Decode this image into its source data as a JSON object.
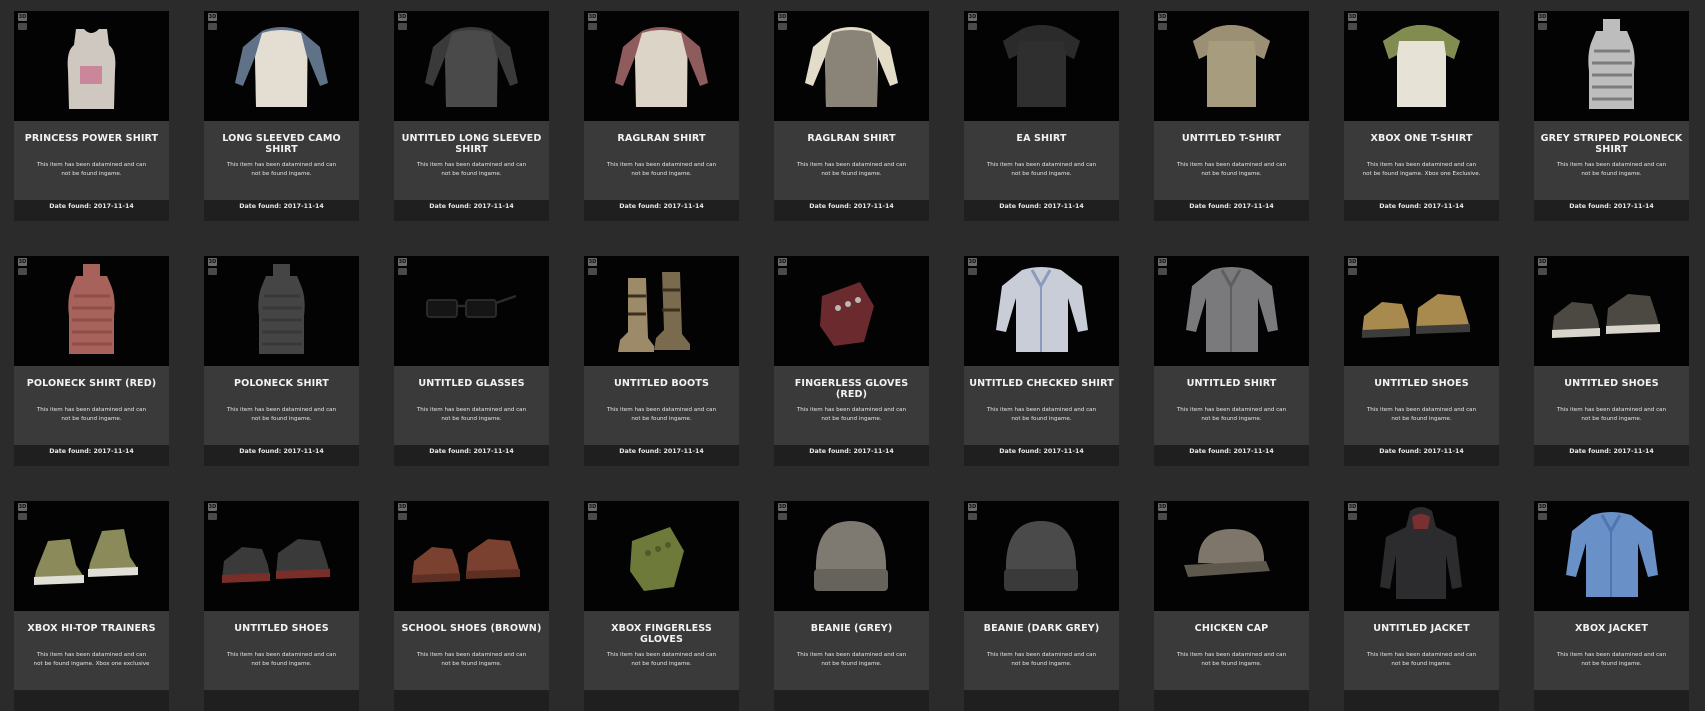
{
  "items": [
    {
      "title": "PRINCESS POWER SHIRT",
      "description": "This item has been datamined and can not be found ingame.",
      "date_found": "Date found: 2017-11-14",
      "icon": "tank-top-shirt-icon",
      "colors": [
        "#cfc8c0",
        "#c86a8a"
      ],
      "badges": [
        "3D",
        "XB"
      ]
    },
    {
      "title": "LONG SLEEVED CAMO SHIRT",
      "description": "This item has been datamined and can not be found ingame.",
      "date_found": "Date found: 2017-11-14",
      "icon": "long-sleeve-shirt-icon",
      "colors": [
        "#e3ddd2",
        "#5f7288"
      ],
      "badges": [
        "3D",
        "XB"
      ]
    },
    {
      "title": "UNTITLED LONG SLEEVED SHIRT",
      "description": "This item has been datamined and can not be found ingame.",
      "date_found": "Date found: 2017-11-14",
      "icon": "long-sleeve-shirt-icon",
      "colors": [
        "#4a4a4a",
        "#3a3a3a"
      ],
      "badges": [
        "3D",
        "XB"
      ]
    },
    {
      "title": "RAGLRAN SHIRT",
      "description": "This item has been datamined and can not be found ingame.",
      "date_found": "Date found: 2017-11-14",
      "icon": "long-sleeve-shirt-icon",
      "colors": [
        "#ddd4c8",
        "#8f5c5e"
      ],
      "badges": [
        "3D",
        "XB"
      ]
    },
    {
      "title": "RAGLRAN SHIRT",
      "description": "This item has been datamined and can not be found ingame.",
      "date_found": "Date found: 2017-11-14",
      "icon": "long-sleeve-shirt-icon",
      "colors": [
        "#8a8478",
        "#e2dcc8"
      ],
      "badges": [
        "3D",
        "XB"
      ]
    },
    {
      "title": "EA SHIRT",
      "description": "This item has been datamined and can not be found ingame.",
      "date_found": "Date found: 2017-11-14",
      "icon": "t-shirt-icon",
      "colors": [
        "#2f2f2f",
        "#2a2a2a"
      ],
      "badges": [
        "3D",
        "XB"
      ]
    },
    {
      "title": "UNTITLED T-SHIRT",
      "description": "This item has been datamined and can not be found ingame.",
      "date_found": "Date found: 2017-11-14",
      "icon": "t-shirt-icon",
      "colors": [
        "#a89c7e",
        "#9a8e72"
      ],
      "badges": [
        "3D",
        "XB"
      ]
    },
    {
      "title": "XBOX ONE T-SHIRT",
      "description": "This item has been datamined and can not be found ingame. Xbox one Exclusive.",
      "date_found": "Date found: 2017-11-14",
      "icon": "t-shirt-icon",
      "colors": [
        "#e6e2d6",
        "#6f7d3a"
      ],
      "badges": [
        "3D",
        "XB"
      ]
    },
    {
      "title": "GREY STRIPED POLONECK SHIRT",
      "description": "This item has been datamined and can not be found ingame.",
      "date_found": "Date found: 2017-11-14",
      "icon": "poloneck-shirt-icon",
      "colors": [
        "#bdbdbd",
        "#7c7c7c"
      ],
      "badges": [
        "3D",
        "XB"
      ]
    },
    {
      "title": "POLONECK SHIRT (RED)",
      "description": "This item has been datamined and can not be found ingame.",
      "date_found": "Date found: 2017-11-14",
      "icon": "poloneck-shirt-icon",
      "colors": [
        "#a8625c",
        "#8e4e48"
      ],
      "badges": [
        "3D",
        "XB"
      ]
    },
    {
      "title": "POLONECK SHIRT",
      "description": "This item has been datamined and can not be found ingame.",
      "date_found": "Date found: 2017-11-14",
      "icon": "poloneck-shirt-icon",
      "colors": [
        "#454545",
        "#383838"
      ],
      "badges": [
        "3D",
        "XB"
      ]
    },
    {
      "title": "UNTITLED GLASSES",
      "description": "This item has been datamined and can not be found ingame.",
      "date_found": "Date found: 2017-11-14",
      "icon": "glasses-icon",
      "colors": [
        "#151515",
        "#2a2a2a"
      ],
      "badges": [
        "3D",
        "XB"
      ]
    },
    {
      "title": "UNTITLED BOOTS",
      "description": "This item has been datamined and can not be found ingame.",
      "date_found": "Date found: 2017-11-14",
      "icon": "boots-icon",
      "colors": [
        "#9c8a68",
        "#7a6a4e"
      ],
      "badges": [
        "3D",
        "XB"
      ]
    },
    {
      "title": "FINGERLESS GLOVES (RED)",
      "description": "This item has been datamined and can not be found ingame.",
      "date_found": "Date found: 2017-11-14",
      "icon": "fingerless-gloves-icon",
      "colors": [
        "#6b2a2e",
        "#b8b8b8"
      ],
      "badges": [
        "3D",
        "XB"
      ]
    },
    {
      "title": "UNTITLED CHECKED SHIRT",
      "description": "This item has been datamined and can not be found ingame.",
      "date_found": "Date found: 2017-11-14",
      "icon": "button-shirt-icon",
      "colors": [
        "#c9cdd8",
        "#8a9bc0"
      ],
      "badges": [
        "3D",
        "XB"
      ]
    },
    {
      "title": "UNTITLED SHIRT",
      "description": "This item has been datamined and can not be found ingame.",
      "date_found": "Date found: 2017-11-14",
      "icon": "button-shirt-icon",
      "colors": [
        "#7a7a7c",
        "#5e5e60"
      ],
      "badges": [
        "3D",
        "XB"
      ]
    },
    {
      "title": "UNTITLED SHOES",
      "description": "This item has been datamined and can not be found ingame.",
      "date_found": "Date found: 2017-11-14",
      "icon": "shoes-icon",
      "colors": [
        "#a98a4e",
        "#3c3c3a"
      ],
      "badges": [
        "3D",
        "XB"
      ]
    },
    {
      "title": "UNTITLED SHOES",
      "description": "This item has been datamined and can not be found ingame.",
      "date_found": "Date found: 2017-11-14",
      "icon": "shoes-icon",
      "colors": [
        "#4c4842",
        "#d8d4cc"
      ],
      "badges": [
        "3D",
        "XB"
      ]
    },
    {
      "title": "XBOX HI-TOP TRAINERS",
      "description": "This item has been datamined and can not be found ingame. Xbox one exclusive",
      "date_found": "",
      "icon": "hi-top-trainers-icon",
      "colors": [
        "#8a8a5a",
        "#e0e0d8"
      ],
      "badges": [
        "3D",
        "XB"
      ]
    },
    {
      "title": "UNTITLED SHOES",
      "description": "This item has been datamined and can not be found ingame.",
      "date_found": "",
      "icon": "shoes-icon",
      "colors": [
        "#3a3a3a",
        "#7a2e2a"
      ],
      "badges": [
        "3D",
        "XB"
      ]
    },
    {
      "title": "SCHOOL SHOES (BROWN)",
      "description": "This item has been datamined and can not be found ingame.",
      "date_found": "",
      "icon": "shoes-icon",
      "colors": [
        "#7a4030",
        "#5e3024"
      ],
      "badges": [
        "3D",
        "XB"
      ]
    },
    {
      "title": "XBOX FINGERLESS GLOVES",
      "description": "This item has been datamined and can not be found ingame.",
      "date_found": "",
      "icon": "fingerless-gloves-icon",
      "colors": [
        "#6e7a3a",
        "#4e5a28"
      ],
      "badges": [
        "3D",
        "XB"
      ]
    },
    {
      "title": "BEANIE (GREY)",
      "description": "This item has been datamined and can not be found ingame.",
      "date_found": "",
      "icon": "beanie-icon",
      "colors": [
        "#7e7a72",
        "#66625c"
      ],
      "badges": [
        "3D",
        "XB"
      ]
    },
    {
      "title": "BEANIE (DARK GREY)",
      "description": "This item has been datamined and can not be found ingame.",
      "date_found": "",
      "icon": "beanie-icon",
      "colors": [
        "#4a4a4a",
        "#3a3a3a"
      ],
      "badges": [
        "3D",
        "XB"
      ]
    },
    {
      "title": "CHICKEN CAP",
      "description": "This item has been datamined and can not be found ingame.",
      "date_found": "",
      "icon": "cap-icon",
      "colors": [
        "#7e766a",
        "#5e574c"
      ],
      "badges": [
        "3D",
        "XB"
      ]
    },
    {
      "title": "UNTITLED JACKET",
      "description": "This item has been datamined and can not be found ingame.",
      "date_found": "",
      "icon": "hooded-jacket-icon",
      "colors": [
        "#2c2c2e",
        "#7a3030"
      ],
      "badges": [
        "3D",
        "XB"
      ]
    },
    {
      "title": "XBOX JACKET",
      "description": "This item has been datamined and can not be found ingame.",
      "date_found": "",
      "icon": "button-shirt-icon",
      "colors": [
        "#6a90c8",
        "#4f76b2"
      ],
      "badges": [
        "3D",
        "XB"
      ]
    }
  ]
}
